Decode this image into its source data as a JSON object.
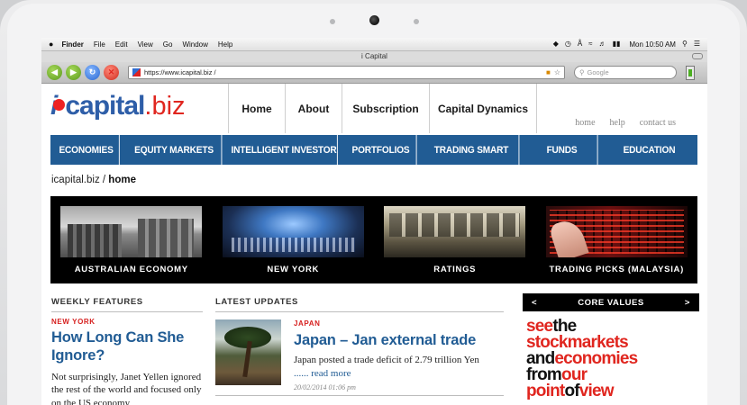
{
  "menubar": {
    "apple": "",
    "items": [
      "Finder",
      "File",
      "Edit",
      "View",
      "Go",
      "Window",
      "Help"
    ],
    "clock": "Mon 10:50 AM"
  },
  "browser": {
    "title": "i Capital",
    "url": "https://www.icapital.biz /",
    "search_placeholder": "Google"
  },
  "site": {
    "logo": {
      "i": "i",
      "capital": "capital",
      "biz": ".biz"
    },
    "topnav": [
      "Home",
      "About",
      "Subscription",
      "Capital Dynamics"
    ],
    "util": [
      "home",
      "help",
      "contact us"
    ],
    "categories": [
      "ECONOMIES",
      "EQUITY MARKETS",
      "INTELLIGENT INVESTOR",
      "PORTFOLIOS",
      "TRADING SMART",
      "FUNDS",
      "EDUCATION"
    ],
    "breadcrumb": {
      "root": "icapital.biz",
      "sep": " / ",
      "current": "home"
    },
    "features": [
      "AUSTRALIAN ECONOMY",
      "NEW YORK",
      "RATINGS",
      "TRADING PICKS (MALAYSIA)"
    ],
    "weekly": {
      "heading": "WEEKLY FEATURES",
      "kicker": "NEW YORK",
      "headline": "How Long Can She Ignore?",
      "body": "Not surprisingly, Janet Yellen ignored the rest of the world and focused only on the US economy"
    },
    "latest": {
      "heading": "LATEST UPDATES",
      "kicker": "JAPAN",
      "headline": "Japan – Jan external trade",
      "body": "Japan posted a trade deficit of 2.79 trillion Yen",
      "more": "...... read more",
      "date": "20/02/2014 01:06 pm"
    },
    "core_values": {
      "prev": "<",
      "title": "CORE VALUES",
      "next": ">",
      "lines": [
        [
          "see",
          "the"
        ],
        [
          "stock",
          "markets"
        ],
        [
          "and",
          "economies"
        ],
        [
          "from",
          "our"
        ],
        [
          "point",
          "of",
          "view"
        ]
      ]
    }
  }
}
